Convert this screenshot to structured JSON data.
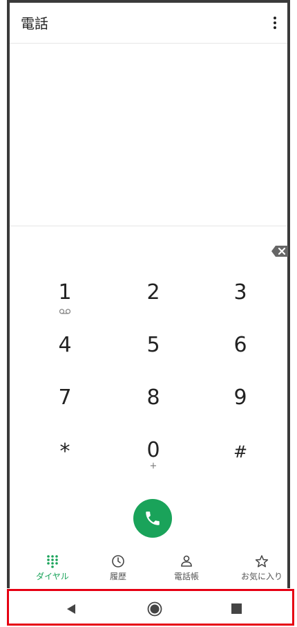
{
  "app_title": "電話",
  "dialpad": {
    "keys": [
      {
        "digit": "1",
        "sub": "voicemail"
      },
      {
        "digit": "2",
        "sub": ""
      },
      {
        "digit": "3",
        "sub": ""
      },
      {
        "digit": "4",
        "sub": ""
      },
      {
        "digit": "5",
        "sub": ""
      },
      {
        "digit": "6",
        "sub": ""
      },
      {
        "digit": "7",
        "sub": ""
      },
      {
        "digit": "8",
        "sub": ""
      },
      {
        "digit": "9",
        "sub": ""
      },
      {
        "digit": "*",
        "sub": ""
      },
      {
        "digit": "0",
        "sub": "+"
      },
      {
        "digit": "#",
        "sub": ""
      }
    ]
  },
  "tabs": {
    "dial": "ダイヤル",
    "history": "履歴",
    "contacts": "電話帳",
    "favorites": "お気に入り"
  },
  "colors": {
    "accent": "#1aa35a",
    "highlight_border": "#e60012"
  },
  "icons": {
    "backspace": "backspace-icon",
    "call": "phone-icon",
    "nav_back": "back-triangle-icon",
    "nav_home": "home-circle-icon",
    "nav_recent": "recents-square-icon"
  }
}
